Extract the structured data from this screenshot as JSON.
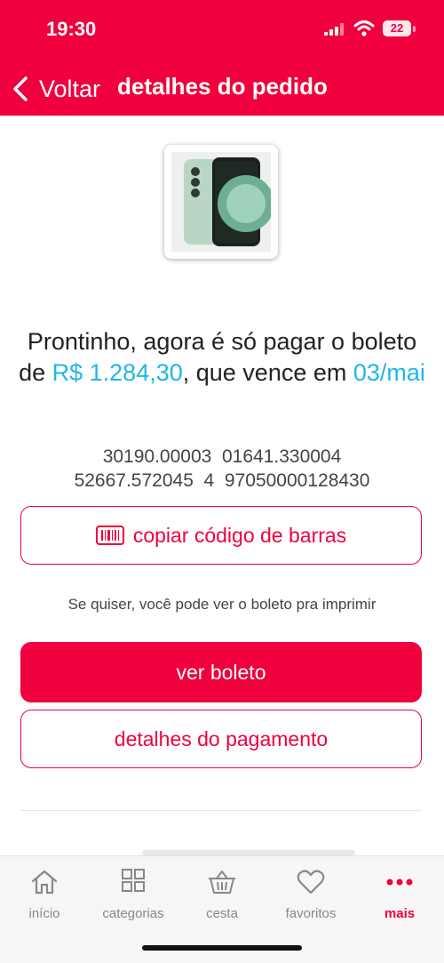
{
  "status_bar": {
    "time": "19:30",
    "battery": "22"
  },
  "header": {
    "back_label": "Voltar",
    "title": "detalhes do pedido"
  },
  "message": {
    "part1": "Prontinho, agora é só pagar o boleto de ",
    "amount": "R$ 1.284,30",
    "part2": ", que vence em ",
    "due_date": "03/mai"
  },
  "barcode": {
    "line1": "30190.00003  01641.330004",
    "line2": "52667.572045  4  97050000128430"
  },
  "buttons": {
    "copy_barcode": "copiar código de barras",
    "view_boleto": "ver boleto",
    "payment_details": "detalhes do pagamento"
  },
  "hint": "Se quiser, você pode ver o boleto pra imprimir",
  "tabs": [
    {
      "label": "início",
      "icon": "home-icon",
      "active": false
    },
    {
      "label": "categorias",
      "icon": "grid-icon",
      "active": false
    },
    {
      "label": "cesta",
      "icon": "basket-icon",
      "active": false
    },
    {
      "label": "favoritos",
      "icon": "heart-icon",
      "active": false
    },
    {
      "label": "mais",
      "icon": "more-icon",
      "active": true
    }
  ],
  "colors": {
    "brand": "#f0003c",
    "highlight": "#21b6e8"
  }
}
